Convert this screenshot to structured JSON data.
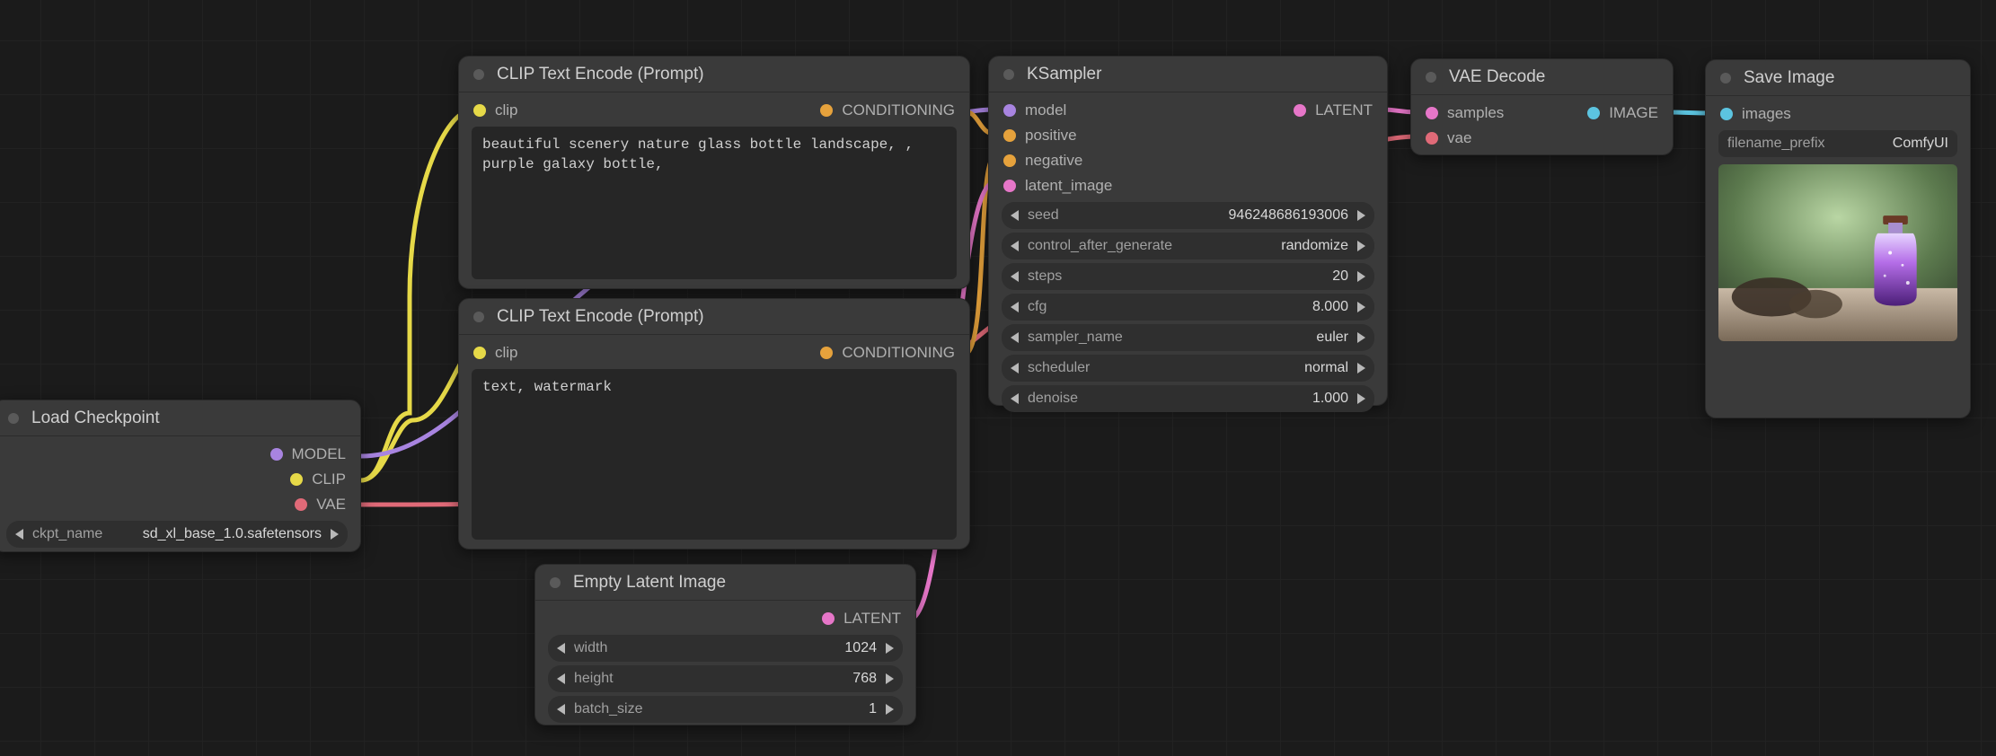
{
  "nodes": {
    "load_checkpoint": {
      "title": "Load Checkpoint",
      "outputs": {
        "model": "MODEL",
        "clip": "CLIP",
        "vae": "VAE"
      },
      "widgets": {
        "ckpt_name": {
          "label": "ckpt_name",
          "value": "sd_xl_base_1.0.safetensors"
        }
      }
    },
    "clip_positive": {
      "title": "CLIP Text Encode (Prompt)",
      "inputs": {
        "clip": "clip"
      },
      "outputs": {
        "conditioning": "CONDITIONING"
      },
      "text": "beautiful scenery nature glass bottle landscape, , purple galaxy bottle,"
    },
    "clip_negative": {
      "title": "CLIP Text Encode (Prompt)",
      "inputs": {
        "clip": "clip"
      },
      "outputs": {
        "conditioning": "CONDITIONING"
      },
      "text": "text, watermark"
    },
    "empty_latent": {
      "title": "Empty Latent Image",
      "outputs": {
        "latent": "LATENT"
      },
      "widgets": {
        "width": {
          "label": "width",
          "value": "1024"
        },
        "height": {
          "label": "height",
          "value": "768"
        },
        "batch_size": {
          "label": "batch_size",
          "value": "1"
        }
      }
    },
    "ksampler": {
      "title": "KSampler",
      "inputs": {
        "model": "model",
        "positive": "positive",
        "negative": "negative",
        "latent_image": "latent_image"
      },
      "outputs": {
        "latent": "LATENT"
      },
      "widgets": {
        "seed": {
          "label": "seed",
          "value": "946248686193006"
        },
        "control": {
          "label": "control_after_generate",
          "value": "randomize"
        },
        "steps": {
          "label": "steps",
          "value": "20"
        },
        "cfg": {
          "label": "cfg",
          "value": "8.000"
        },
        "sampler": {
          "label": "sampler_name",
          "value": "euler"
        },
        "scheduler": {
          "label": "scheduler",
          "value": "normal"
        },
        "denoise": {
          "label": "denoise",
          "value": "1.000"
        }
      }
    },
    "vae_decode": {
      "title": "VAE Decode",
      "inputs": {
        "samples": "samples",
        "vae": "vae"
      },
      "outputs": {
        "image": "IMAGE"
      }
    },
    "save_image": {
      "title": "Save Image",
      "inputs": {
        "images": "images"
      },
      "widgets": {
        "filename_prefix": {
          "label": "filename_prefix",
          "value": "ComfyUI"
        }
      }
    }
  },
  "colors": {
    "yellow": "#e6d948",
    "orange": "#e6a23c",
    "purple": "#a884e0",
    "red": "#e06a78",
    "pink": "#e676c8",
    "cyan": "#5cc4e0"
  }
}
